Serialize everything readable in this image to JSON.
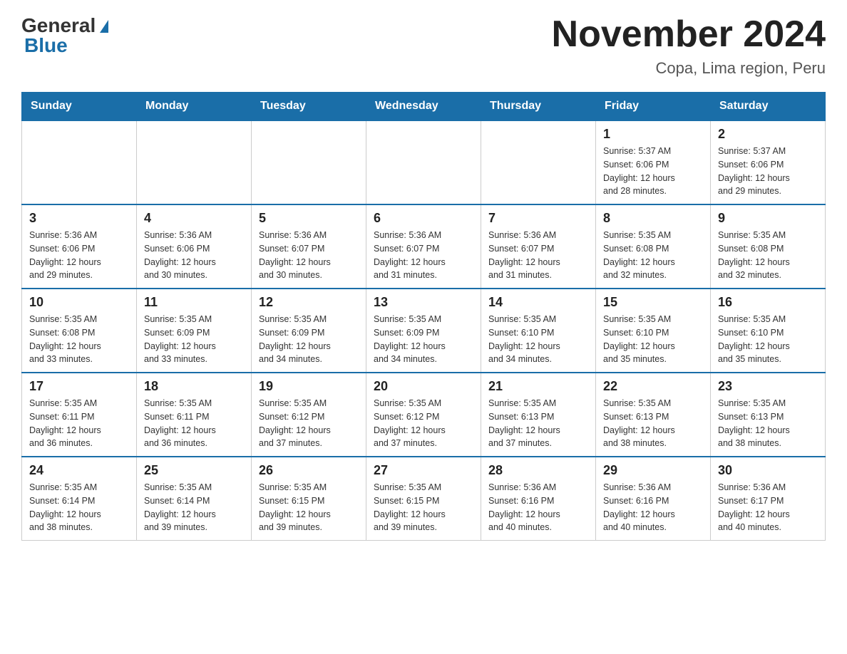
{
  "header": {
    "logo_general": "General",
    "logo_blue": "Blue",
    "month_title": "November 2024",
    "location": "Copa, Lima region, Peru"
  },
  "days_of_week": [
    "Sunday",
    "Monday",
    "Tuesday",
    "Wednesday",
    "Thursday",
    "Friday",
    "Saturday"
  ],
  "weeks": [
    [
      {
        "day": "",
        "info": ""
      },
      {
        "day": "",
        "info": ""
      },
      {
        "day": "",
        "info": ""
      },
      {
        "day": "",
        "info": ""
      },
      {
        "day": "",
        "info": ""
      },
      {
        "day": "1",
        "info": "Sunrise: 5:37 AM\nSunset: 6:06 PM\nDaylight: 12 hours\nand 28 minutes."
      },
      {
        "day": "2",
        "info": "Sunrise: 5:37 AM\nSunset: 6:06 PM\nDaylight: 12 hours\nand 29 minutes."
      }
    ],
    [
      {
        "day": "3",
        "info": "Sunrise: 5:36 AM\nSunset: 6:06 PM\nDaylight: 12 hours\nand 29 minutes."
      },
      {
        "day": "4",
        "info": "Sunrise: 5:36 AM\nSunset: 6:06 PM\nDaylight: 12 hours\nand 30 minutes."
      },
      {
        "day": "5",
        "info": "Sunrise: 5:36 AM\nSunset: 6:07 PM\nDaylight: 12 hours\nand 30 minutes."
      },
      {
        "day": "6",
        "info": "Sunrise: 5:36 AM\nSunset: 6:07 PM\nDaylight: 12 hours\nand 31 minutes."
      },
      {
        "day": "7",
        "info": "Sunrise: 5:36 AM\nSunset: 6:07 PM\nDaylight: 12 hours\nand 31 minutes."
      },
      {
        "day": "8",
        "info": "Sunrise: 5:35 AM\nSunset: 6:08 PM\nDaylight: 12 hours\nand 32 minutes."
      },
      {
        "day": "9",
        "info": "Sunrise: 5:35 AM\nSunset: 6:08 PM\nDaylight: 12 hours\nand 32 minutes."
      }
    ],
    [
      {
        "day": "10",
        "info": "Sunrise: 5:35 AM\nSunset: 6:08 PM\nDaylight: 12 hours\nand 33 minutes."
      },
      {
        "day": "11",
        "info": "Sunrise: 5:35 AM\nSunset: 6:09 PM\nDaylight: 12 hours\nand 33 minutes."
      },
      {
        "day": "12",
        "info": "Sunrise: 5:35 AM\nSunset: 6:09 PM\nDaylight: 12 hours\nand 34 minutes."
      },
      {
        "day": "13",
        "info": "Sunrise: 5:35 AM\nSunset: 6:09 PM\nDaylight: 12 hours\nand 34 minutes."
      },
      {
        "day": "14",
        "info": "Sunrise: 5:35 AM\nSunset: 6:10 PM\nDaylight: 12 hours\nand 34 minutes."
      },
      {
        "day": "15",
        "info": "Sunrise: 5:35 AM\nSunset: 6:10 PM\nDaylight: 12 hours\nand 35 minutes."
      },
      {
        "day": "16",
        "info": "Sunrise: 5:35 AM\nSunset: 6:10 PM\nDaylight: 12 hours\nand 35 minutes."
      }
    ],
    [
      {
        "day": "17",
        "info": "Sunrise: 5:35 AM\nSunset: 6:11 PM\nDaylight: 12 hours\nand 36 minutes."
      },
      {
        "day": "18",
        "info": "Sunrise: 5:35 AM\nSunset: 6:11 PM\nDaylight: 12 hours\nand 36 minutes."
      },
      {
        "day": "19",
        "info": "Sunrise: 5:35 AM\nSunset: 6:12 PM\nDaylight: 12 hours\nand 37 minutes."
      },
      {
        "day": "20",
        "info": "Sunrise: 5:35 AM\nSunset: 6:12 PM\nDaylight: 12 hours\nand 37 minutes."
      },
      {
        "day": "21",
        "info": "Sunrise: 5:35 AM\nSunset: 6:13 PM\nDaylight: 12 hours\nand 37 minutes."
      },
      {
        "day": "22",
        "info": "Sunrise: 5:35 AM\nSunset: 6:13 PM\nDaylight: 12 hours\nand 38 minutes."
      },
      {
        "day": "23",
        "info": "Sunrise: 5:35 AM\nSunset: 6:13 PM\nDaylight: 12 hours\nand 38 minutes."
      }
    ],
    [
      {
        "day": "24",
        "info": "Sunrise: 5:35 AM\nSunset: 6:14 PM\nDaylight: 12 hours\nand 38 minutes."
      },
      {
        "day": "25",
        "info": "Sunrise: 5:35 AM\nSunset: 6:14 PM\nDaylight: 12 hours\nand 39 minutes."
      },
      {
        "day": "26",
        "info": "Sunrise: 5:35 AM\nSunset: 6:15 PM\nDaylight: 12 hours\nand 39 minutes."
      },
      {
        "day": "27",
        "info": "Sunrise: 5:35 AM\nSunset: 6:15 PM\nDaylight: 12 hours\nand 39 minutes."
      },
      {
        "day": "28",
        "info": "Sunrise: 5:36 AM\nSunset: 6:16 PM\nDaylight: 12 hours\nand 40 minutes."
      },
      {
        "day": "29",
        "info": "Sunrise: 5:36 AM\nSunset: 6:16 PM\nDaylight: 12 hours\nand 40 minutes."
      },
      {
        "day": "30",
        "info": "Sunrise: 5:36 AM\nSunset: 6:17 PM\nDaylight: 12 hours\nand 40 minutes."
      }
    ]
  ]
}
